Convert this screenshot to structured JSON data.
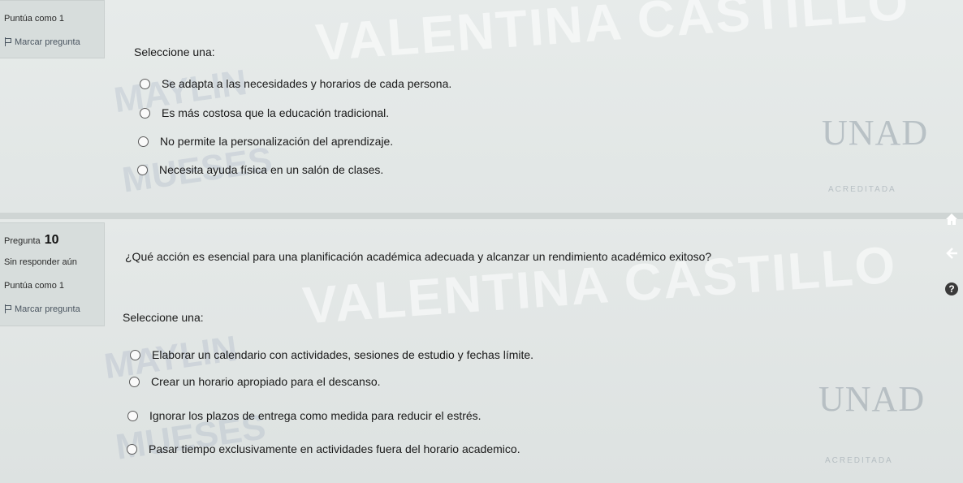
{
  "question9": {
    "points": "Puntúa como 1",
    "flag_label": "Marcar pregunta",
    "prompt": "Seleccione una:",
    "options": [
      "Se adapta a las necesidades y horarios de cada persona.",
      "Es más costosa que la educación tradicional.",
      "No permite la personalización del aprendizaje.",
      "Necesita ayuda física en un salón de clases."
    ]
  },
  "question10": {
    "label": "Pregunta",
    "number": "10",
    "status": "Sin responder aún",
    "points": "Puntúa como 1",
    "flag_label": "Marcar pregunta",
    "text": "¿Qué acción es esencial para una planificación académica adecuada y alcanzar un rendimiento académico exitoso?",
    "prompt": "Seleccione una:",
    "options": [
      "Elaborar un calendario con actividades, sesiones de estudio y fechas límite.",
      "Crear un horario apropiado para el descanso.",
      "Ignorar los plazos de entrega como medida para reducir el estrés.",
      "Pasar tiempo exclusivamente en actividades fuera del horario academico."
    ]
  },
  "watermark": {
    "name": "VALENTINA CASTILLO",
    "first": "MAYLIN",
    "last": "MUESES",
    "logo": "UNAD",
    "accredited": "ACREDITADA"
  },
  "sidebar": {
    "home_icon": "home-icon",
    "back_icon": "back-arrow-icon",
    "help_icon": "help-icon",
    "help_glyph": "?"
  }
}
